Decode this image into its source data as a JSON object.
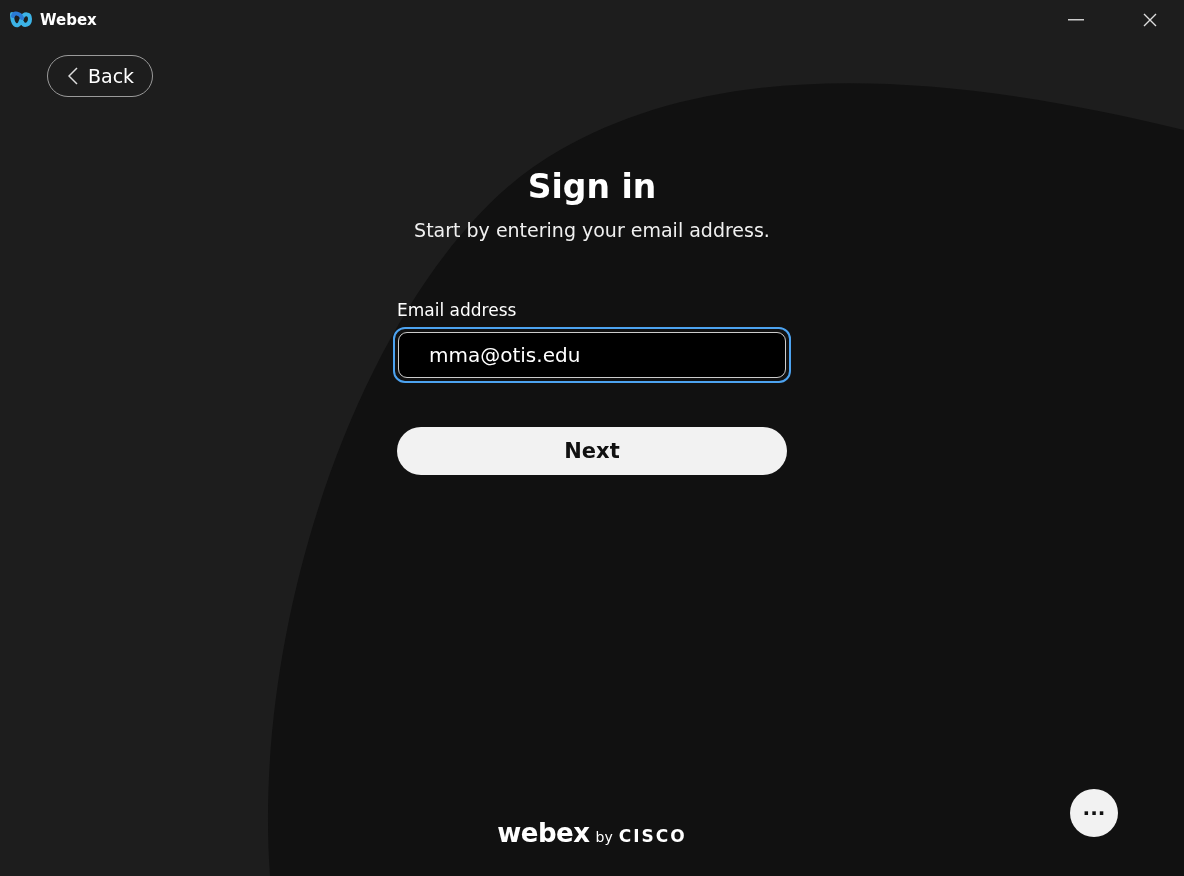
{
  "window": {
    "title": "Webex"
  },
  "back_button": {
    "label": "Back"
  },
  "heading": "Sign in",
  "subtitle": "Start by entering your email address.",
  "email_field": {
    "label": "Email address",
    "value": "mma@otis.edu",
    "focused": true
  },
  "next_button": {
    "label": "Next"
  },
  "footer_logo": {
    "brand": "webex",
    "by": "by",
    "company": "CISCO"
  },
  "more_button": {
    "label": "···"
  }
}
